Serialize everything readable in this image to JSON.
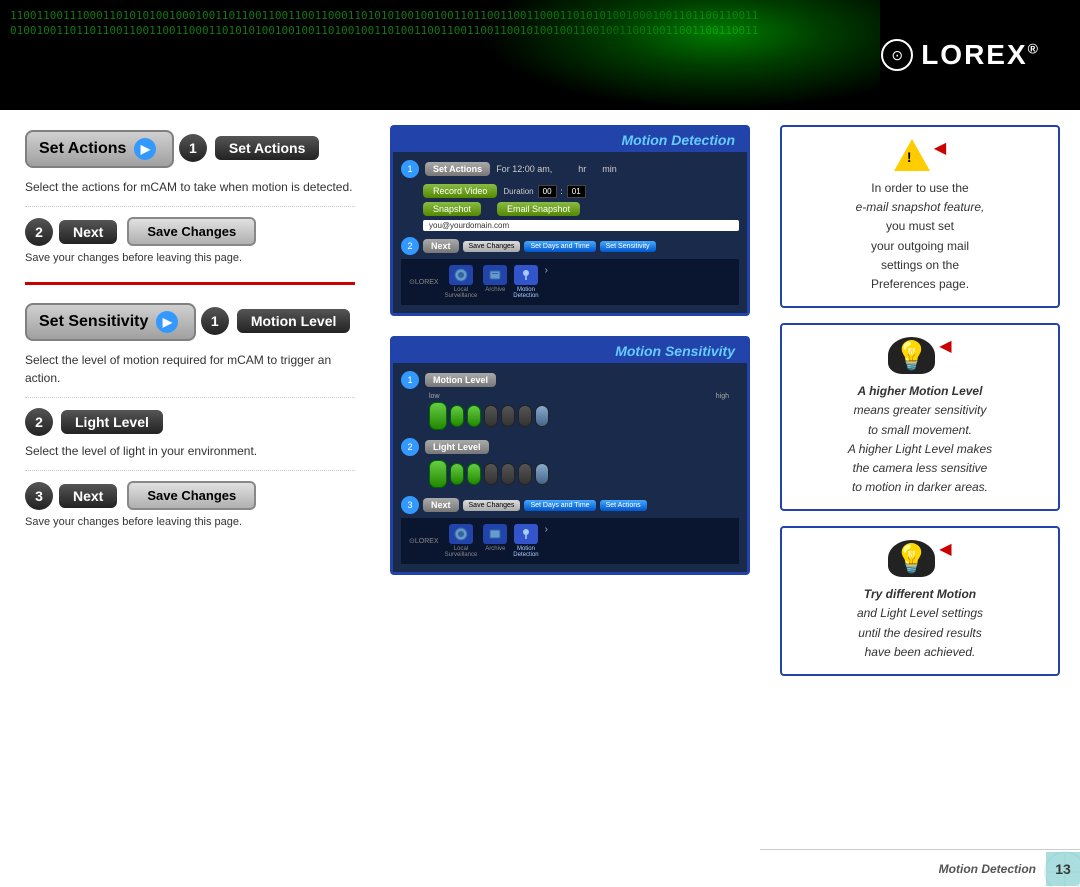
{
  "header": {
    "binary_text": "11001100111000110101010010001001101100110011001100011010101001001001101100110011000110101010010001001101100110011",
    "binary_text2": "01001001101101100110011001100011010101001001001101001001101001100110011001100101001001100100110010011001100110011",
    "logo_text": "LOREX",
    "logo_reg": "®"
  },
  "left_col": {
    "section1": {
      "pill_label": "Set Actions",
      "step1_label": "Set Actions",
      "step1_desc": "Select the actions for mCAM to take when motion is detected.",
      "step2_label": "Next",
      "save_btn": "Save Changes",
      "save_note": "Save your changes before leaving this page."
    },
    "section2": {
      "pill_label": "Set Sensitivity",
      "step1_label": "Motion Level",
      "step1_desc": "Select the level of motion required for mCAM to trigger an action.",
      "step2_label": "Light Level",
      "step2_desc": "Select the level of light in your environment.",
      "step3_label": "Next",
      "save_btn": "Save Changes",
      "save_note": "Save your changes before leaving this page."
    }
  },
  "screenshots": {
    "motion_detection": {
      "title": "Motion Detection",
      "step1_label": "Set Actions",
      "time_text": "For 12:00 am,",
      "hr_label": "hr",
      "min_label": "min",
      "record_btn": "Record Video",
      "duration_label": "Duration",
      "time_hr": "00",
      "time_colon": ":",
      "time_min": "01",
      "snapshot_btn": "Snapshot",
      "email_btn": "Email Snapshot",
      "email_placeholder": "you@yourdomain.com",
      "step2_label": "Next",
      "save_btn": "Save Changes",
      "set_days_btn": "Set Days and Time",
      "set_sens_btn": "Set Sensitivity",
      "nav_items": [
        "Local Surveillance",
        "Archive",
        "Motion Detection"
      ]
    },
    "motion_sensitivity": {
      "title": "Motion Sensitivity",
      "step1_label": "Motion Level",
      "low_label": "low",
      "high_label": "high",
      "step2_label": "Light Level",
      "step3_label": "Next",
      "save_btn": "Save Changes",
      "set_days_btn": "Set Days and Time",
      "set_actions_btn": "Set Actions",
      "nav_items": [
        "Local Surveillance",
        "Archive",
        "Motion Detection"
      ]
    }
  },
  "right_col": {
    "box1": {
      "icon": "warning",
      "text_line1": "In order to use the",
      "text_line2": "e-mail snapshot feature,",
      "text_line3": "you must set",
      "text_line4": "your outgoing mail",
      "text_line5": "settings on the",
      "text_line6": "Preferences page."
    },
    "box2": {
      "icon": "lightbulb",
      "text_line1": "A higher Motion Level",
      "text_line2": "means greater sensitivity",
      "text_line3": "to small movement.",
      "text_line4": "A higher Light Level makes",
      "text_line5": "the camera less sensitive",
      "text_line6": "to motion in darker areas."
    },
    "box3": {
      "icon": "lightbulb",
      "text_line1": "Try different Motion",
      "text_line2": "and Light Level settings",
      "text_line3": "until the desired results",
      "text_line4": "have been achieved."
    }
  },
  "footer": {
    "label": "Motion Detection",
    "page_number": "13"
  }
}
